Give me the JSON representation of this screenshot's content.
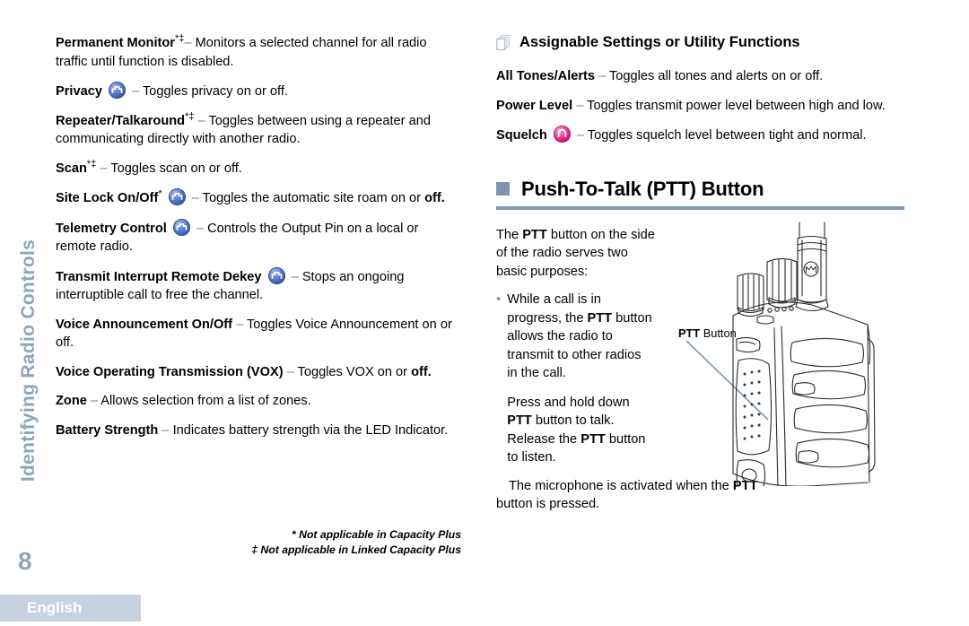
{
  "sidebar": {
    "chapter_title": "Identifying Radio Controls",
    "page_number": "8",
    "language_tab": "English"
  },
  "left_column": {
    "entries": [
      {
        "term": "Permanent Monitor",
        "marks": "*‡",
        "icon": null,
        "dash": "–",
        "description": " Monitors a selected channel for all radio traffic until function is disabled."
      },
      {
        "term": "Privacy",
        "marks": "",
        "icon": "function-button-blue-icon",
        "dash": "–",
        "description": " Toggles privacy on or off."
      },
      {
        "term": "Repeater/Talkaround",
        "marks": "*‡",
        "icon": null,
        "dash": "–",
        "description": " Toggles between using a repeater and communicating directly with another radio."
      },
      {
        "term": "Scan",
        "marks": "*‡",
        "icon": null,
        "dash": "–",
        "description": " Toggles scan on or off."
      },
      {
        "term": "Site Lock On/Off",
        "marks": "*",
        "icon": "function-button-blue-icon",
        "dash": "–",
        "description": " Toggles the automatic site roam on or ",
        "description_bold_tail": "off."
      },
      {
        "term": "Telemetry Control",
        "marks": "",
        "icon": "function-button-blue-icon",
        "dash": "–",
        "description": " Controls the Output Pin on a local or remote radio."
      },
      {
        "term": "Transmit Interrupt Remote Dekey",
        "marks": "",
        "icon": "function-button-blue-icon",
        "dash": "–",
        "description": " Stops an ongoing interruptible call to free the channel."
      },
      {
        "term": "Voice Announcement On/Off",
        "marks": "",
        "icon": null,
        "dash": "–",
        "description": " Toggles Voice Announcement on or off."
      },
      {
        "term": "Voice Operating Transmission (VOX)",
        "marks": "",
        "icon": null,
        "dash": "–",
        "description": " Toggles VOX on or ",
        "description_bold_tail": "off."
      },
      {
        "term": "Zone",
        "marks": "",
        "icon": null,
        "dash": "–",
        "description": " Allows selection from a list of zones."
      },
      {
        "term": "Battery Strength",
        "marks": "",
        "icon": null,
        "dash": "–",
        "description": " Indicates battery strength via the LED Indicator."
      }
    ],
    "footnotes": [
      "* Not applicable in Capacity Plus",
      "‡ Not applicable in Linked Capacity Plus"
    ]
  },
  "right_column": {
    "section_heading": "Assignable Settings or Utility Functions",
    "section_heading_icon": "stacked-pages-icon",
    "entries": [
      {
        "term": "All Tones/Alerts",
        "icon": null,
        "dash": "–",
        "description": " Toggles all tones and alerts on or off."
      },
      {
        "term": "Power Level",
        "icon": null,
        "dash": "–",
        "description": " Toggles transmit power level between high and low."
      },
      {
        "term": "Squelch",
        "icon": "function-button-pink-icon",
        "dash": "–",
        "description": " Toggles squelch level between tight and normal."
      }
    ],
    "ptt_section": {
      "heading": "Push-To-Talk (PTT) Button",
      "heading_bullet_icon": "square-bullet-icon",
      "intro_pre": "The ",
      "intro_bold": "PTT",
      "intro_post": " button on the side of the radio serves two basic purposes:",
      "bullet_1": {
        "seg1": "While a call is in progress, the ",
        "bold1": "PTT",
        "seg2": " button allows the radio to transmit to other radios in the call."
      },
      "bullet_1_cont": {
        "seg1": "Press and hold down ",
        "bold1": "PTT",
        "seg2": " button to talk. Release the ",
        "bold2": "PTT",
        "seg3": " button to listen."
      },
      "closing": {
        "seg1": "The microphone is activated when the ",
        "bold1": "PTT",
        "seg2": " button is pressed."
      },
      "callout_bold": "PTT",
      "callout_rest": " Button",
      "figure_name": "two-way-radio-illustration"
    }
  },
  "colors": {
    "accent_blue": "#7e97b8",
    "sidebar_text": "#8fa4bd",
    "language_tab_bg": "#c6d2e0",
    "dash_color": "#6d7fa0",
    "icon_blue": "#3a5cb0",
    "icon_pink": "#e2338f"
  }
}
